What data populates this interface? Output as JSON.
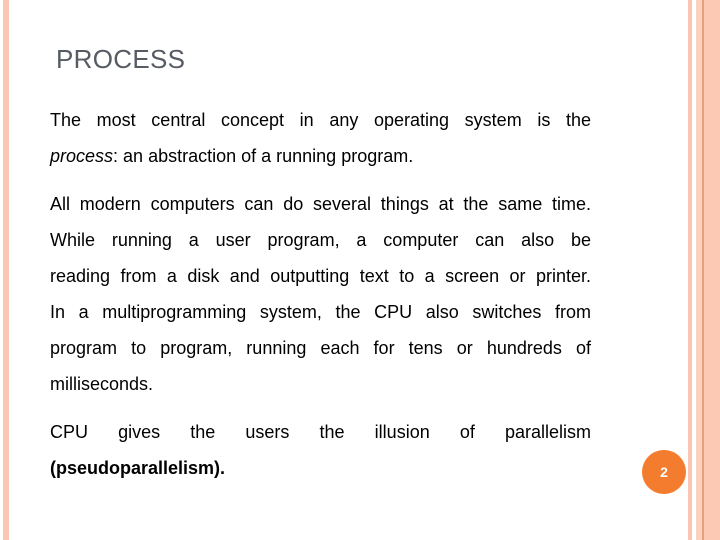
{
  "slide": {
    "title": "PROCESS",
    "paragraphs": [
      {
        "lines": [
          "The most central concept in any operating system is the",
          "an abstraction of a running program."
        ],
        "emphasis_term": "process",
        "emphasis_suffix": ": "
      },
      {
        "lines": [
          "All modern computers can do several things at the same time.",
          "While running a user program, a computer can also be",
          "reading from a disk and outputting text to a screen or printer.",
          "In a multiprogramming system, the CPU also switches from",
          "program to program, running each for tens or hundreds of",
          "milliseconds."
        ]
      },
      {
        "lines": [
          "CPU gives the users the illusion of parallelism",
          "(pseudoparallelism)."
        ],
        "bold_term": "pseudoparallelism"
      }
    ],
    "page_number": "2"
  },
  "colors": {
    "accent": "#f47c2e",
    "border": "#f9c6b4",
    "title": "#575b64"
  }
}
